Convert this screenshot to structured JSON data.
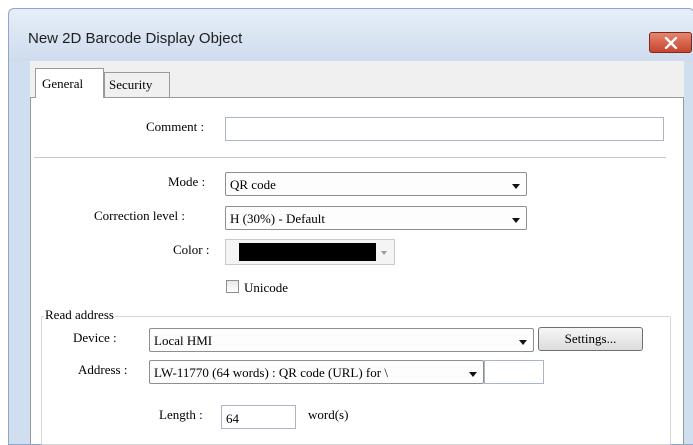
{
  "window": {
    "title": "New 2D Barcode Display Object",
    "close_icon": "close-x-icon"
  },
  "tabs": [
    {
      "label": "General",
      "active": true
    },
    {
      "label": "Security",
      "active": false
    }
  ],
  "general": {
    "comment_label": "Comment :",
    "comment_value": "",
    "mode_label": "Mode :",
    "mode_value": "QR code",
    "correction_label": "Correction level :",
    "correction_value": "H (30%) - Default",
    "color_label": "Color :",
    "color_value": "#000000",
    "unicode_label": "Unicode",
    "unicode_checked": false
  },
  "read_address": {
    "group_label": "Read address",
    "device_label": "Device :",
    "device_value": "Local HMI",
    "settings_button": "Settings...",
    "address_label": "Address :",
    "address_value": "LW-11770 (64 words) : QR code (URL) for \\",
    "address_extra_value": "",
    "length_label": "Length :",
    "length_value": "64",
    "length_unit": "word(s)"
  }
}
